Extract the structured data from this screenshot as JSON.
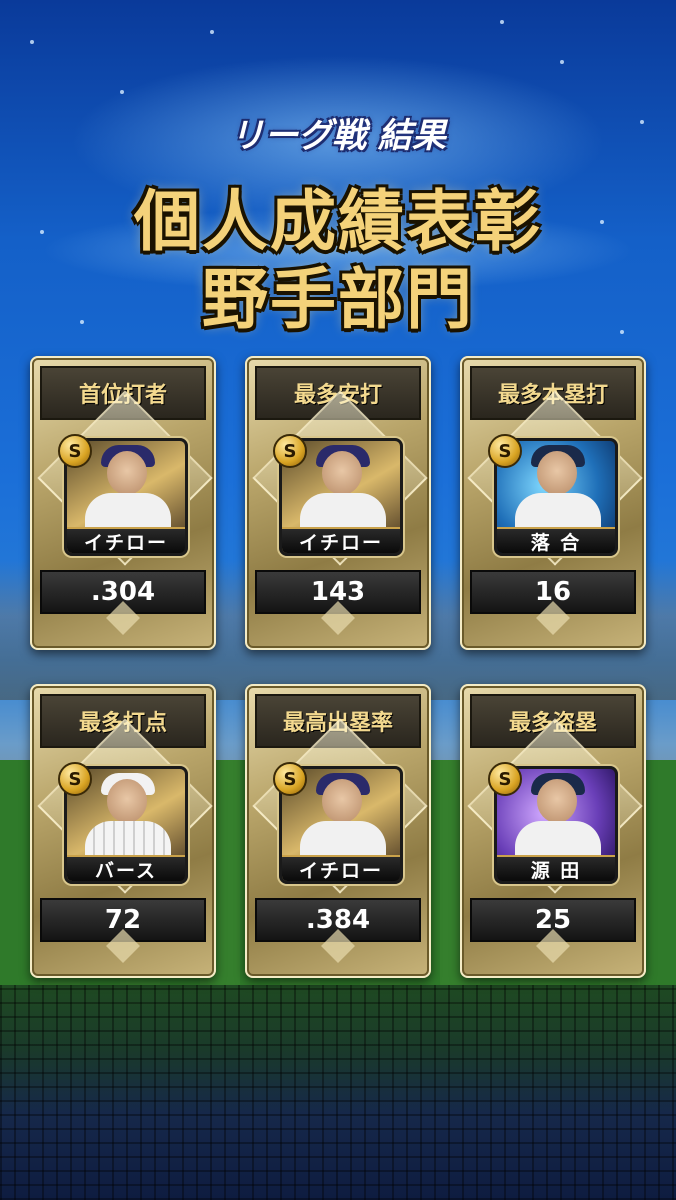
{
  "header": {
    "subtitle": "リーグ戦 結果",
    "title_line1": "個人成績表彰",
    "title_line2": "野手部門"
  },
  "awards": [
    {
      "title": "首位打者",
      "player": "イチロー",
      "rank_badge": "S",
      "value": ".304",
      "portrait": "gold"
    },
    {
      "title": "最多安打",
      "player": "イチロー",
      "rank_badge": "S",
      "value": "143",
      "portrait": "gold"
    },
    {
      "title": "最多本塁打",
      "player": "落 合",
      "rank_badge": "S",
      "value": "16",
      "portrait": "blue"
    },
    {
      "title": "最多打点",
      "player": "バース",
      "rank_badge": "S",
      "value": "72",
      "portrait": "gold"
    },
    {
      "title": "最高出塁率",
      "player": "イチロー",
      "rank_badge": "S",
      "value": ".384",
      "portrait": "gold"
    },
    {
      "title": "最多盗塁",
      "player": "源 田",
      "rank_badge": "S",
      "value": "25",
      "portrait": "purple"
    }
  ],
  "colors": {
    "title_gold": "#f4d27a",
    "card_gold": "#b9a56a",
    "label_gold": "#f3d98f"
  }
}
